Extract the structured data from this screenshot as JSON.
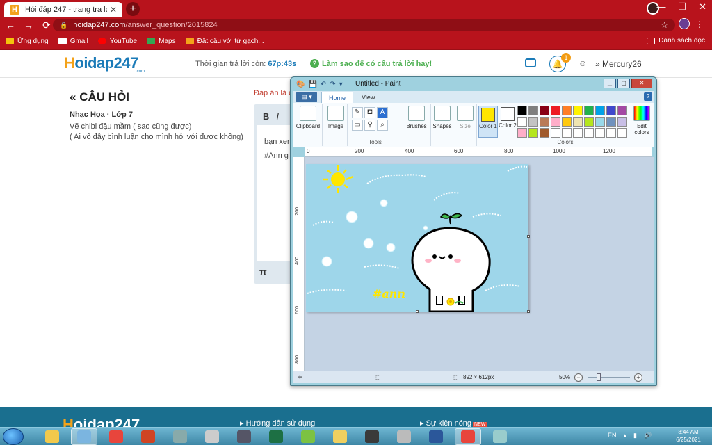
{
  "browser": {
    "tab_title": "Hỏi đáp 247 - trang tra loi",
    "favicon_letter": "H",
    "url_host": "hoidap247.com",
    "url_path": "/answer_question/2015824",
    "bookmarks": [
      {
        "label": "Ứng dụng",
        "color": "#f4c20d"
      },
      {
        "label": "Gmail",
        "color": "#ffffff"
      },
      {
        "label": "YouTube",
        "color": "#ff0000"
      },
      {
        "label": "Maps",
        "color": "#34a853"
      },
      {
        "label": "Đặt câu với từ gạch...",
        "color": "#f3a21a"
      }
    ],
    "reading_list": "Danh sách đọc"
  },
  "site": {
    "logo_h": "H",
    "logo_rest": "oidap247",
    "logo_sub": ".com",
    "timer_label": "Thời gian trả lời còn:",
    "timer_value": "67p:43s",
    "tip": "Làm sao để có câu trả lời hay!",
    "notif_count": "1",
    "username": "Mercury26"
  },
  "question": {
    "heading": "CÂU HỎI",
    "subject": "Nhạc Họa · Lớp 7",
    "line1": "Vẽ chibi đậu mầm ( sao cũng được)",
    "line2": "( Ai vô đây bình luận cho mình hỏi với được không)",
    "answer_label": "Đáp án là c",
    "editor_bold": "B",
    "editor_italic": "I",
    "editor_text1": "bạn xem",
    "editor_text2": "#Ann g",
    "editor_pi": "π"
  },
  "footer": {
    "logo_h": "H",
    "logo_rest": "oidap247",
    "link1": "Hướng dẫn sử dụng",
    "link2": "Sự kiện nóng",
    "new_badge": "NEW"
  },
  "paint": {
    "title": "Untitled - Paint",
    "file_btn": "▤ ▾",
    "tab_home": "Home",
    "tab_view": "View",
    "help": "?",
    "clipboard": "Clipboard",
    "image": "Image",
    "tools": "Tools",
    "brushes": "Brushes",
    "shapes": "Shapes",
    "size": "Size",
    "color1": "Color 1",
    "color2": "Color 2",
    "colors": "Colors",
    "edit_colors": "Edit colors",
    "color1_value": "#ffe600",
    "color2_value": "#ffffff",
    "palette": [
      "#000000",
      "#7f7f7f",
      "#880015",
      "#ed1c24",
      "#ff7f27",
      "#fff200",
      "#22b14c",
      "#00a2e8",
      "#3f48cc",
      "#a349a4",
      "#ffffff",
      "#c3c3c3",
      "#b97a57",
      "#ffaec9",
      "#ffc90e",
      "#efe4b0",
      "#b5e61d",
      "#99d9ea",
      "#7092be",
      "#c8bfe7",
      "#ffaec9",
      "#b5e61d",
      "#a05a2c",
      "#ffffff",
      "#ffffff",
      "#ffffff",
      "#ffffff",
      "#ffffff",
      "#ffffff",
      "#ffffff"
    ],
    "ruler_top": [
      "0",
      "200",
      "400",
      "600",
      "800",
      "1000",
      "1200"
    ],
    "ruler_left": [
      "200",
      "400",
      "600",
      "800"
    ],
    "drawing_tag": "#ann",
    "canvas_size": "892 × 612px",
    "zoom": "50%"
  },
  "taskbar": {
    "lang": "EN",
    "time": "8:44 AM",
    "date": "6/25/2021",
    "apps": [
      {
        "name": "explorer",
        "color": "#f2c94c"
      },
      {
        "name": "paint",
        "color": "#7bb5e0",
        "active": true
      },
      {
        "name": "chrome",
        "color": "#e8453c"
      },
      {
        "name": "powerpoint",
        "color": "#d04423"
      },
      {
        "name": "app5",
        "color": "#8aa"
      },
      {
        "name": "app6",
        "color": "#ccc"
      },
      {
        "name": "app7",
        "color": "#556"
      },
      {
        "name": "excel",
        "color": "#1d7044"
      },
      {
        "name": "app9",
        "color": "#7cc242"
      },
      {
        "name": "app10",
        "color": "#f0d060"
      },
      {
        "name": "app11",
        "color": "#3a3a3a"
      },
      {
        "name": "app12",
        "color": "#bbb"
      },
      {
        "name": "word",
        "color": "#2b579a"
      },
      {
        "name": "chrome2",
        "color": "#e8453c",
        "active": true
      },
      {
        "name": "app15",
        "color": "#9cc"
      }
    ]
  }
}
